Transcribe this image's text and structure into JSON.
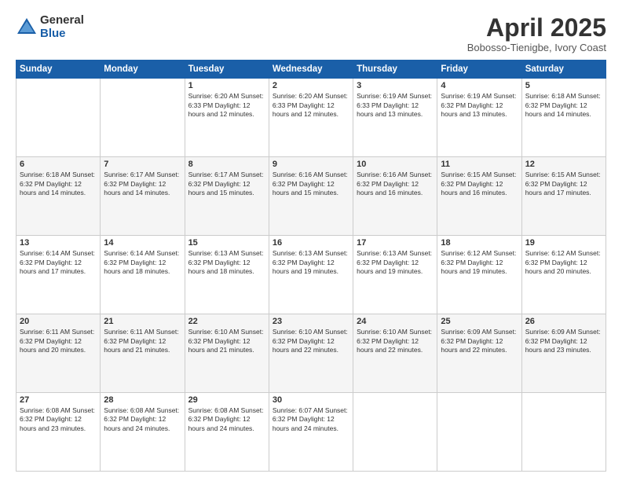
{
  "logo": {
    "general": "General",
    "blue": "Blue"
  },
  "title": "April 2025",
  "location": "Bobosso-Tienigbe, Ivory Coast",
  "days_of_week": [
    "Sunday",
    "Monday",
    "Tuesday",
    "Wednesday",
    "Thursday",
    "Friday",
    "Saturday"
  ],
  "weeks": [
    [
      {
        "day": "",
        "info": ""
      },
      {
        "day": "",
        "info": ""
      },
      {
        "day": "1",
        "info": "Sunrise: 6:20 AM\nSunset: 6:33 PM\nDaylight: 12 hours and 12 minutes."
      },
      {
        "day": "2",
        "info": "Sunrise: 6:20 AM\nSunset: 6:33 PM\nDaylight: 12 hours and 12 minutes."
      },
      {
        "day": "3",
        "info": "Sunrise: 6:19 AM\nSunset: 6:33 PM\nDaylight: 12 hours and 13 minutes."
      },
      {
        "day": "4",
        "info": "Sunrise: 6:19 AM\nSunset: 6:32 PM\nDaylight: 12 hours and 13 minutes."
      },
      {
        "day": "5",
        "info": "Sunrise: 6:18 AM\nSunset: 6:32 PM\nDaylight: 12 hours and 14 minutes."
      }
    ],
    [
      {
        "day": "6",
        "info": "Sunrise: 6:18 AM\nSunset: 6:32 PM\nDaylight: 12 hours and 14 minutes."
      },
      {
        "day": "7",
        "info": "Sunrise: 6:17 AM\nSunset: 6:32 PM\nDaylight: 12 hours and 14 minutes."
      },
      {
        "day": "8",
        "info": "Sunrise: 6:17 AM\nSunset: 6:32 PM\nDaylight: 12 hours and 15 minutes."
      },
      {
        "day": "9",
        "info": "Sunrise: 6:16 AM\nSunset: 6:32 PM\nDaylight: 12 hours and 15 minutes."
      },
      {
        "day": "10",
        "info": "Sunrise: 6:16 AM\nSunset: 6:32 PM\nDaylight: 12 hours and 16 minutes."
      },
      {
        "day": "11",
        "info": "Sunrise: 6:15 AM\nSunset: 6:32 PM\nDaylight: 12 hours and 16 minutes."
      },
      {
        "day": "12",
        "info": "Sunrise: 6:15 AM\nSunset: 6:32 PM\nDaylight: 12 hours and 17 minutes."
      }
    ],
    [
      {
        "day": "13",
        "info": "Sunrise: 6:14 AM\nSunset: 6:32 PM\nDaylight: 12 hours and 17 minutes."
      },
      {
        "day": "14",
        "info": "Sunrise: 6:14 AM\nSunset: 6:32 PM\nDaylight: 12 hours and 18 minutes."
      },
      {
        "day": "15",
        "info": "Sunrise: 6:13 AM\nSunset: 6:32 PM\nDaylight: 12 hours and 18 minutes."
      },
      {
        "day": "16",
        "info": "Sunrise: 6:13 AM\nSunset: 6:32 PM\nDaylight: 12 hours and 19 minutes."
      },
      {
        "day": "17",
        "info": "Sunrise: 6:13 AM\nSunset: 6:32 PM\nDaylight: 12 hours and 19 minutes."
      },
      {
        "day": "18",
        "info": "Sunrise: 6:12 AM\nSunset: 6:32 PM\nDaylight: 12 hours and 19 minutes."
      },
      {
        "day": "19",
        "info": "Sunrise: 6:12 AM\nSunset: 6:32 PM\nDaylight: 12 hours and 20 minutes."
      }
    ],
    [
      {
        "day": "20",
        "info": "Sunrise: 6:11 AM\nSunset: 6:32 PM\nDaylight: 12 hours and 20 minutes."
      },
      {
        "day": "21",
        "info": "Sunrise: 6:11 AM\nSunset: 6:32 PM\nDaylight: 12 hours and 21 minutes."
      },
      {
        "day": "22",
        "info": "Sunrise: 6:10 AM\nSunset: 6:32 PM\nDaylight: 12 hours and 21 minutes."
      },
      {
        "day": "23",
        "info": "Sunrise: 6:10 AM\nSunset: 6:32 PM\nDaylight: 12 hours and 22 minutes."
      },
      {
        "day": "24",
        "info": "Sunrise: 6:10 AM\nSunset: 6:32 PM\nDaylight: 12 hours and 22 minutes."
      },
      {
        "day": "25",
        "info": "Sunrise: 6:09 AM\nSunset: 6:32 PM\nDaylight: 12 hours and 22 minutes."
      },
      {
        "day": "26",
        "info": "Sunrise: 6:09 AM\nSunset: 6:32 PM\nDaylight: 12 hours and 23 minutes."
      }
    ],
    [
      {
        "day": "27",
        "info": "Sunrise: 6:08 AM\nSunset: 6:32 PM\nDaylight: 12 hours and 23 minutes."
      },
      {
        "day": "28",
        "info": "Sunrise: 6:08 AM\nSunset: 6:32 PM\nDaylight: 12 hours and 24 minutes."
      },
      {
        "day": "29",
        "info": "Sunrise: 6:08 AM\nSunset: 6:32 PM\nDaylight: 12 hours and 24 minutes."
      },
      {
        "day": "30",
        "info": "Sunrise: 6:07 AM\nSunset: 6:32 PM\nDaylight: 12 hours and 24 minutes."
      },
      {
        "day": "",
        "info": ""
      },
      {
        "day": "",
        "info": ""
      },
      {
        "day": "",
        "info": ""
      }
    ]
  ]
}
